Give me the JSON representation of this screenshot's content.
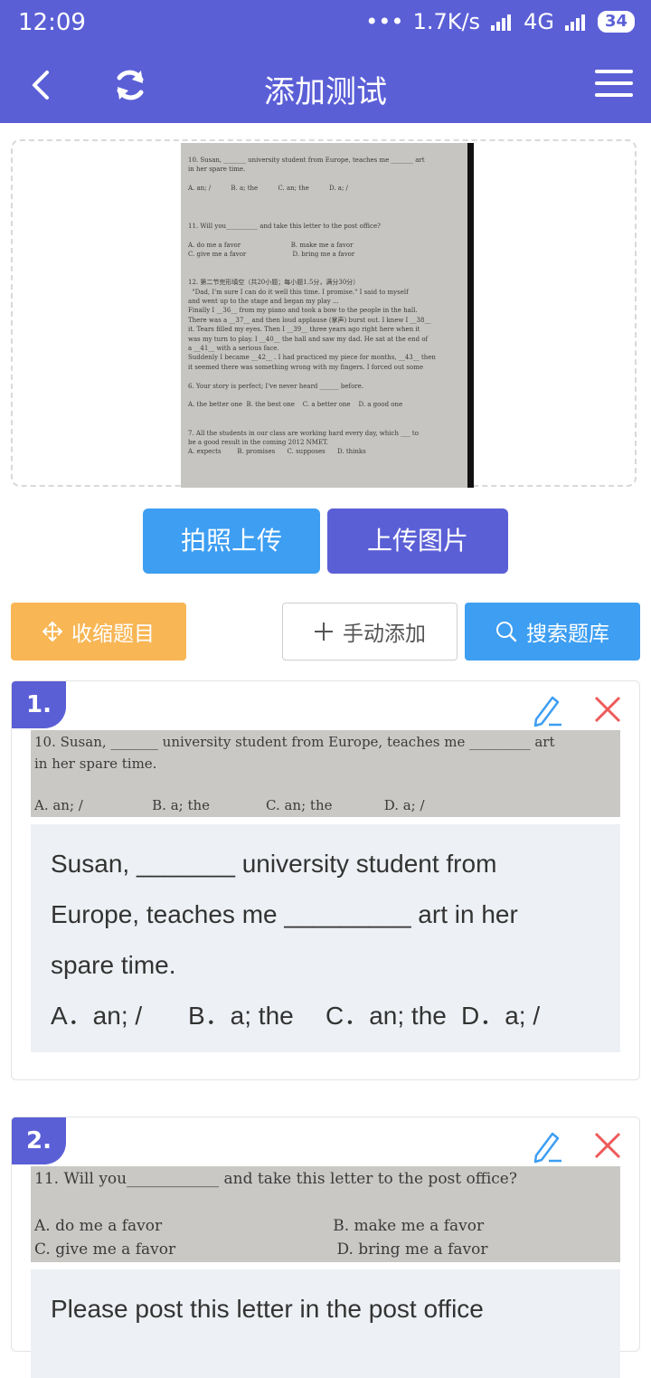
{
  "status": {
    "time": "12:09",
    "dots": "•••",
    "speed": "1.7K/s",
    "network": "4G",
    "battery": "34"
  },
  "header": {
    "title": "添加测试"
  },
  "preview": {
    "lines": [
      "10. Susan, _______ university student from Europe, teaches me _______ art",
      "in her spare time.",
      "",
      "A. an; /          B. a; the          C. an; the          D. a; /",
      "",
      "",
      "",
      "11. Will you__________ and take this letter to the post office?",
      "",
      "A. do me a favor                         B. make me a favor",
      "C. give me a favor                       D. bring me a favor",
      "",
      "",
      "12. 第二节完形填空（共20小题；每小题1.5分，满分30分）",
      "  \"Dad, I'm sure I can do it well this time. I promise.\" I said to myself",
      "and went up to the stage and began my play ...",
      "Finally I __36__ from my piano and took a bow to the people in the hall.",
      "There was a __37__ and then loud applause (掌声) burst out. I knew I __38__",
      "it. Tears filled my eyes. Then I __39__ three years ago right here when it",
      "was my turn to play. I __40__ the hall and saw my dad. He sat at the end of",
      "a __41__ with a serious face.",
      "Suddenly I became __42__ . I had practiced my piece for months, __43__ then",
      "it seemed there was something wrong with my fingers. I forced out some",
      "",
      "6. Your story is perfect; I've never heard ______ before.",
      "",
      "A. the better one  B. the best one    C. a better one    D. a good one",
      "",
      "",
      "7. All the students in our class are working hard every day, which ___ to",
      "be a good result in the coming 2012 NMET.",
      "A. expects        B. promises      C. supposes      D. thinks"
    ]
  },
  "buttons": {
    "take_photo": "拍照上传",
    "upload_image": "上传图片",
    "collapse": "收缩题目",
    "manual_add": "手动添加",
    "search_bank": "搜索题库"
  },
  "questions": [
    {
      "number": "1.",
      "scan_lines": [
        "10. Susan, _______ university student from Europe, teaches me _________ art",
        "in her spare time.",
        "A. an; /                B. a; the             C. an; the            D. a; /"
      ],
      "text_line1": "Susan, _______ university student from",
      "text_line2": "Europe, teaches me _________ art in her",
      "text_line3": "spare time.",
      "options": [
        "A．an; /",
        "B．a; the",
        "C．an; the",
        "D．a; /"
      ]
    },
    {
      "number": "2.",
      "scan_lines": [
        "11. Will you____________ and take this letter to the post office?",
        "A. do me a favor                                   B. make me a favor",
        "C. give me a favor                                 D. bring me a favor"
      ],
      "text_line1": "Please post this letter in the post office"
    }
  ]
}
